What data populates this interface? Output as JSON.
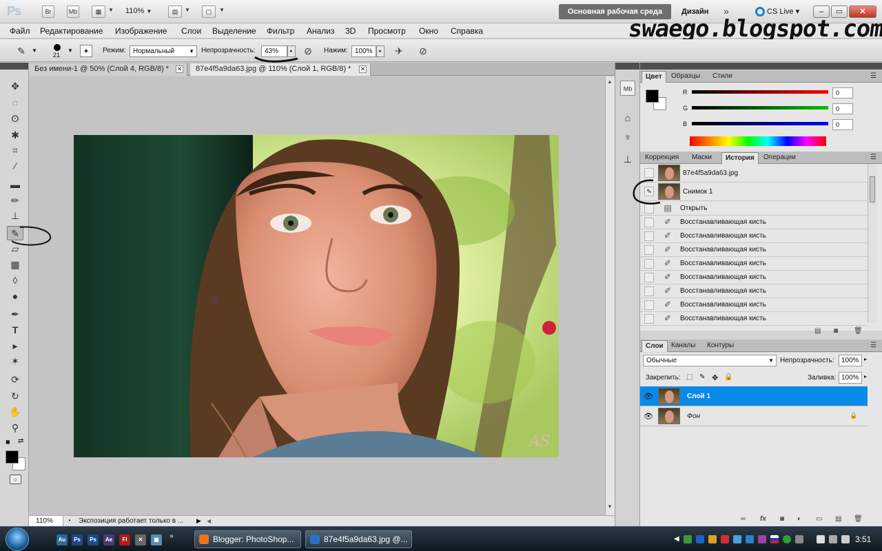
{
  "appbar": {
    "logo": "Ps",
    "br_label": "Br",
    "mb_label": "Mb",
    "zoom": "110%",
    "workspace_active": "Основная рабочая среда",
    "workspace_design": "Дизайн",
    "more": "»",
    "cs_live": "CS Live"
  },
  "watermark": "swaego.blogspot.com",
  "menu": [
    "Файл",
    "Редактирование",
    "Изображение",
    "Слои",
    "Выделение",
    "Фильтр",
    "Анализ",
    "3D",
    "Просмотр",
    "Окно",
    "Справка"
  ],
  "options": {
    "brush_size": "21",
    "mode_label": "Режим:",
    "mode_value": "Нормальный",
    "opacity_label": "Непрозрачность:",
    "opacity_value": "43%",
    "flow_label": "Нажим:",
    "flow_value": "100%"
  },
  "tabs": [
    {
      "label": "Без имени-1 @ 50% (Слой 4, RGB/8) *",
      "active": false
    },
    {
      "label": "87e4f5a9da63.jpg @ 110% (Слой 1, RGB/8) *",
      "active": true
    }
  ],
  "status": {
    "zoom": "110%",
    "message": "Экспозиция работает только в ..."
  },
  "color_panel": {
    "tabs": [
      "Цвет",
      "Образцы",
      "Стили"
    ],
    "channels": [
      {
        "label": "R",
        "value": "0",
        "color": "#ff0000"
      },
      {
        "label": "G",
        "value": "0",
        "color": "#00c000"
      },
      {
        "label": "B",
        "value": "0",
        "color": "#0000ff"
      }
    ]
  },
  "history_panel": {
    "tabs": [
      "Коррекция",
      "Маски",
      "История",
      "Операции"
    ],
    "snapshots": [
      "87e4f5a9da63.jpg",
      "Снимок 1"
    ],
    "steps": [
      "Открыть",
      "Восстанавливающая кисть",
      "Восстанавливающая кисть",
      "Восстанавливающая кисть",
      "Восстанавливающая кисть",
      "Восстанавливающая кисть",
      "Восстанавливающая кисть",
      "Восстанавливающая кисть",
      "Восстанавливающая кисть"
    ]
  },
  "layers_panel": {
    "tabs": [
      "Слои",
      "Каналы",
      "Контуры"
    ],
    "blend_mode": "Обычные",
    "opacity_label": "Непрозрачность:",
    "opacity_value": "100%",
    "lock_label": "Закрепить:",
    "fill_label": "Заливка:",
    "fill_value": "100%",
    "layers": [
      {
        "name": "Слой 1",
        "selected": true,
        "locked": false
      },
      {
        "name": "Фон",
        "selected": false,
        "locked": true
      }
    ]
  },
  "taskbar": {
    "windows": [
      {
        "label": "Blogger: PhotoShop...",
        "icon_color": "#e8741c"
      },
      {
        "label": "87e4f5a9da63.jpg @...",
        "icon_color": "#2b6fc0"
      }
    ],
    "clock": "3:51"
  },
  "photo": {
    "signature": "AS"
  }
}
